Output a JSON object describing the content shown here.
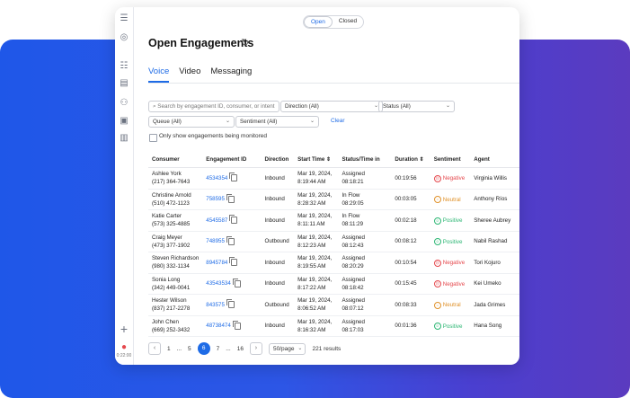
{
  "toggle": {
    "open": "Open",
    "closed": "Closed"
  },
  "title": "Open Engagements",
  "refresh_icon": "↻",
  "tabs": [
    "Voice",
    "Video",
    "Messaging"
  ],
  "filters": {
    "search_placeholder": "Search by engagement ID, consumer, or intent",
    "direction": "Direction (All)",
    "status": "Status (All)",
    "queue": "Queue (All)",
    "sentiment": "Sentiment (All)",
    "clear": "Clear",
    "monitored_label": "Only show engagements being monitored"
  },
  "table": {
    "headers": [
      "Consumer",
      "Engagement ID",
      "Direction",
      "Start Time",
      "Status/Time in",
      "Duration",
      "Sentiment",
      "Agent"
    ],
    "rows": [
      {
        "name": "Ashlee York",
        "phone": "(217) 364-7643",
        "id": "4534354",
        "dir": "Inbound",
        "date": "Mar 19, 2024,",
        "time": "8:19:44 AM",
        "status": "Assigned",
        "status_time": "08:18:21",
        "dur": "00:19:56",
        "sent": "Negative",
        "agent": "Virginia Willis"
      },
      {
        "name": "Christine Arnold",
        "phone": "(510) 472-1123",
        "id": "758595",
        "dir": "Inbound",
        "date": "Mar 19, 2024,",
        "time": "8:28:32 AM",
        "status": "In Flow",
        "status_time": "08:29:05",
        "dur": "00:03:05",
        "sent": "Neutral",
        "agent": "Anthony Ríos"
      },
      {
        "name": "Katie Carter",
        "phone": "(573) 325-4885",
        "id": "4545587",
        "dir": "Inbound",
        "date": "Mar 19, 2024,",
        "time": "8:11:11 AM",
        "status": "In Flow",
        "status_time": "08:11:29",
        "dur": "00:02:18",
        "sent": "Positive",
        "agent": "Sheree Aubrey"
      },
      {
        "name": "Craig Meyer",
        "phone": "(473) 377-1902",
        "id": "748955",
        "dir": "Outbound",
        "date": "Mar 19, 2024,",
        "time": "8:12:23 AM",
        "status": "Assigned",
        "status_time": "08:12:43",
        "dur": "00:08:12",
        "sent": "Positive",
        "agent": "Nabil Rashad"
      },
      {
        "name": "Steven Richardson",
        "phone": "(980) 332-1134",
        "id": "8945784",
        "dir": "Inbound",
        "date": "Mar 19, 2024,",
        "time": "8:19:55 AM",
        "status": "Assigned",
        "status_time": "08:20:29",
        "dur": "00:10:54",
        "sent": "Negative",
        "agent": "Tori Kojuro"
      },
      {
        "name": "Sonia Long",
        "phone": "(342) 449-0041",
        "id": "43543534",
        "dir": "Inbound",
        "date": "Mar 19, 2024,",
        "time": "8:17:22 AM",
        "status": "Assigned",
        "status_time": "08:18:42",
        "dur": "00:15:45",
        "sent": "Negative",
        "agent": "Kei Umeko"
      },
      {
        "name": "Hester Wilson",
        "phone": "(837) 217-2278",
        "id": "843575",
        "dir": "Outbound",
        "date": "Mar 19, 2024,",
        "time": "8:06:52 AM",
        "status": "Assigned",
        "status_time": "08:07:12",
        "dur": "00:08:33",
        "sent": "Neutral",
        "agent": "Jada Grimes"
      },
      {
        "name": "John Chen",
        "phone": "(669) 252-3432",
        "id": "48738474",
        "dir": "Inbound",
        "date": "Mar 19, 2024,",
        "time": "8:16:32 AM",
        "status": "Assigned",
        "status_time": "08:17:03",
        "dur": "00:01:36",
        "sent": "Positive",
        "agent": "Hana Song"
      }
    ]
  },
  "pagination": {
    "pages": [
      "1",
      "...",
      "5",
      "6",
      "7",
      "...",
      "16"
    ],
    "current": "6",
    "per_page": "50/page",
    "results": "221 results"
  },
  "rail_meta": "0:22:00",
  "colors": {
    "accent": "#1e6be6",
    "negative": "#e5484d",
    "neutral": "#e0922b",
    "positive": "#2bb673"
  }
}
